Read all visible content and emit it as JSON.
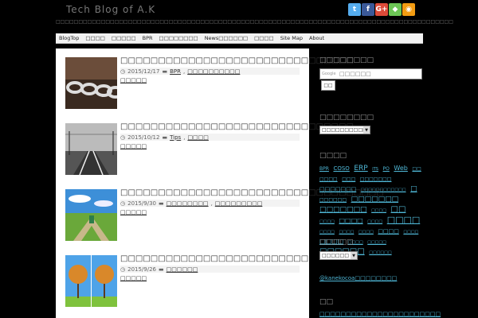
{
  "site": {
    "title": "Tech Blog of A.K",
    "description": "□□□□□□□□□□□□□□□□□□□□□□□□□□□□□□□□□□□□□□□□□□□□□□□□□□□□□□□□□□□□□□□□□□□□□□□□□□□□□□□□□□□□□□□□"
  },
  "social": [
    {
      "name": "twitter",
      "glyph": "t",
      "color": "#55acee"
    },
    {
      "name": "facebook",
      "glyph": "f",
      "color": "#3b5998"
    },
    {
      "name": "googleplus",
      "glyph": "G+",
      "color": "#dd4b39"
    },
    {
      "name": "feedly",
      "glyph": "◆",
      "color": "#6cc655"
    },
    {
      "name": "rss",
      "glyph": "◉",
      "color": "#f39c12"
    }
  ],
  "nav": [
    {
      "id": "blogtop",
      "label": "BlogTop"
    },
    {
      "id": "about-blog",
      "label": "□□□□"
    },
    {
      "id": "category",
      "label": "□□□□□"
    },
    {
      "id": "bpr",
      "label": "BPR"
    },
    {
      "id": "archive",
      "label": "□□□□□□□□"
    },
    {
      "id": "news",
      "label": "News□□□□□□"
    },
    {
      "id": "contact",
      "label": "□□□□"
    },
    {
      "id": "sitemap",
      "label": "Site Map"
    },
    {
      "id": "about",
      "label": "About"
    }
  ],
  "posts": [
    {
      "title": "□□□□□□□□□□□□□□□□□□□□□□□□□□□□□□□",
      "date": "2015/12/17",
      "cats": [
        "BPR",
        "□□□□□□□□□□"
      ],
      "more": "□□□□□",
      "thumb": "chain"
    },
    {
      "title": "□□□□□□□□□□□□□□□□□□□□□□□□□□□□□□□",
      "date": "2015/10/12",
      "cats": [
        "Tips",
        "□□□□"
      ],
      "more": "□□□□□",
      "thumb": "rails"
    },
    {
      "title": "□□□□□□□□□□□□□□□□□□□□□□□□□□□□□□□□□□□",
      "date": "2015/9/30",
      "cats": [
        "□□□□□□□□",
        "□□□□□□□□□"
      ],
      "more": "□□□□□",
      "thumb": "field"
    },
    {
      "title": "□□□□□□□□□□□□□□□□□□□□□□□□□",
      "date": "2015/9/26",
      "cats": [
        "□□□□□□"
      ],
      "more": "□□□□□",
      "thumb": "trees"
    }
  ],
  "sidebar": {
    "search_heading": "□□□□□□□□",
    "search_logo": "Google",
    "search_placeholder": "□□□□□□",
    "search_button": "□□",
    "archive_heading": "□□□□□□□□",
    "archive_select": "□□□□□□□□□□",
    "tags_heading": "□□□□",
    "tags": [
      {
        "t": "BPR",
        "s": 6
      },
      {
        "t": "COSO",
        "s": 7
      },
      {
        "t": "ERP",
        "s": 9
      },
      {
        "t": "ITS",
        "s": 5
      },
      {
        "t": "PO",
        "s": 6
      },
      {
        "t": "Web",
        "s": 8
      },
      {
        "t": "□□",
        "s": 6
      },
      {
        "t": "□□□□",
        "s": 6
      },
      {
        "t": "□□□",
        "s": 6
      },
      {
        "t": "□□□□□□□",
        "s": 6
      },
      {
        "t": "□□□□□□□",
        "s": 7
      },
      {
        "t": "□□□□□□□□□□□□",
        "s": 5
      },
      {
        "t": "□",
        "s": 9
      },
      {
        "t": "□□□□□□",
        "s": 6
      },
      {
        "t": "□□□□□□□",
        "s": 9
      },
      {
        "t": "□□□□□□□",
        "s": 9
      },
      {
        "t": "□□□□",
        "s": 5
      },
      {
        "t": "□□",
        "s": 10
      },
      {
        "t": "□□□□",
        "s": 5
      },
      {
        "t": "□□□□",
        "s": 8
      },
      {
        "t": "□□□□",
        "s": 5
      },
      {
        "t": "□□□□",
        "s": 11
      },
      {
        "t": "□□□□",
        "s": 5
      },
      {
        "t": "□□□□",
        "s": 5
      },
      {
        "t": "□□□□",
        "s": 5
      },
      {
        "t": "□□□□",
        "s": 7
      },
      {
        "t": "□□□□",
        "s": 5
      },
      {
        "t": "□□□□",
        "s": 8
      },
      {
        "t": "□□□□",
        "s": 5
      },
      {
        "t": "□□□□□",
        "s": 5
      },
      {
        "t": "□□□□□□",
        "s": 10
      },
      {
        "t": "□□□□□□",
        "s": 5
      }
    ],
    "cat_heading": "□□□□□",
    "cat_select": "□□□□□□",
    "twitter_link": "@kanekocoa□□□□□□□□",
    "last_heading": "□□",
    "last_link": "□□□□□□□□□□□□□□□□□□□□□□□"
  }
}
